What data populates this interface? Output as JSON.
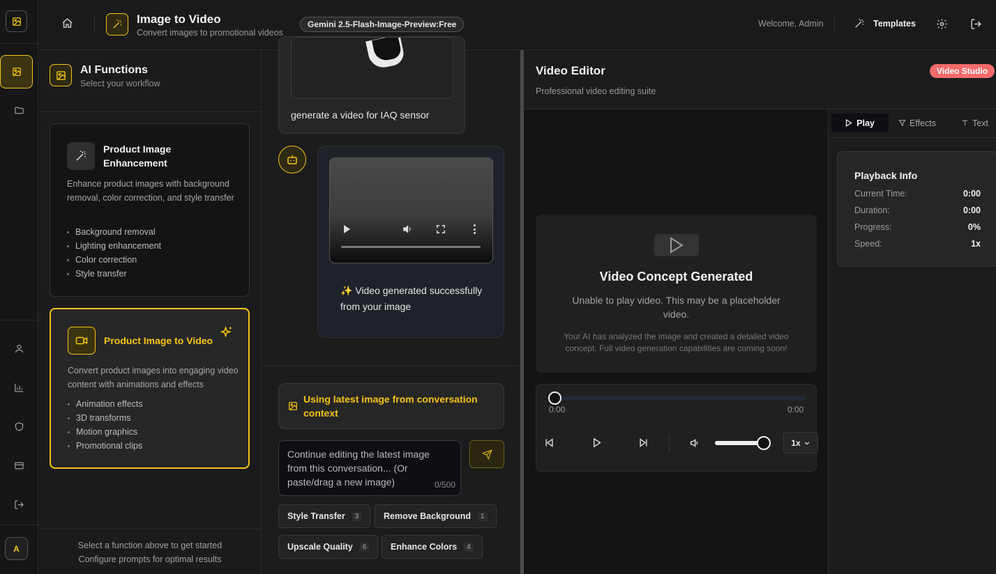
{
  "header": {
    "title": "Image to Video",
    "subtitle": "Convert images to promotional videos",
    "model_badge": "Gemini 2.5-Flash-Image-Preview:Free",
    "welcome": "Welcome, Admin",
    "templates_label": "Templates"
  },
  "rail": {
    "avatar_letter": "A"
  },
  "functions": {
    "title": "AI Functions",
    "subtitle": "Select your workflow",
    "cards": [
      {
        "title": "Product Image Enhancement",
        "description": "Enhance product images with background removal, color correction, and style transfer",
        "features": [
          "Background removal",
          "Lighting enhancement",
          "Color correction",
          "Style transfer"
        ]
      },
      {
        "title": "Product Image to Video",
        "description": "Convert product images into engaging video content with animations and effects",
        "features": [
          "Animation effects",
          "3D transforms",
          "Motion graphics",
          "Promotional clips"
        ]
      }
    ],
    "footer_line1": "Select a function above to get started",
    "footer_line2": "Configure prompts for optimal results"
  },
  "chat": {
    "user_message": "generate a video for IAQ sensor",
    "bot_message": "✨ Video generated successfully from your image",
    "context_notice": "Using latest image from conversation context",
    "input_placeholder": "Continue editing the latest image from this conversation... (Or paste/drag a new image)",
    "char_count": "0/500",
    "quick_actions": [
      {
        "label": "Style Transfer",
        "count": "3"
      },
      {
        "label": "Remove Background",
        "count": "1"
      },
      {
        "label": "Upscale Quality",
        "count": "6"
      },
      {
        "label": "Enhance Colors",
        "count": "4"
      }
    ]
  },
  "editor": {
    "title": "Video Editor",
    "subtitle": "Professional video editing suite",
    "badge": "Video Studio",
    "badge_color": "#f26b6b",
    "placeholder_title": "Video Concept Generated",
    "placeholder_msg": "Unable to play video. This may be a placeholder video.",
    "placeholder_note": "Your AI has analyzed the image and created a detailed video concept. Full video generation capabilities are coming soon!",
    "time_start": "0:00",
    "time_end": "0:00",
    "volume_level": 1.0,
    "speed": "1x",
    "tabs": [
      "Play",
      "Effects",
      "Text"
    ],
    "playback": {
      "title": "Playback Info",
      "rows": [
        {
          "label": "Current Time:",
          "value": "0:00"
        },
        {
          "label": "Duration:",
          "value": "0:00"
        },
        {
          "label": "Progress:",
          "value": "0%"
        },
        {
          "label": "Speed:",
          "value": "1x"
        }
      ]
    }
  },
  "colors": {
    "accent": "#f5c518",
    "background": "#191919"
  }
}
